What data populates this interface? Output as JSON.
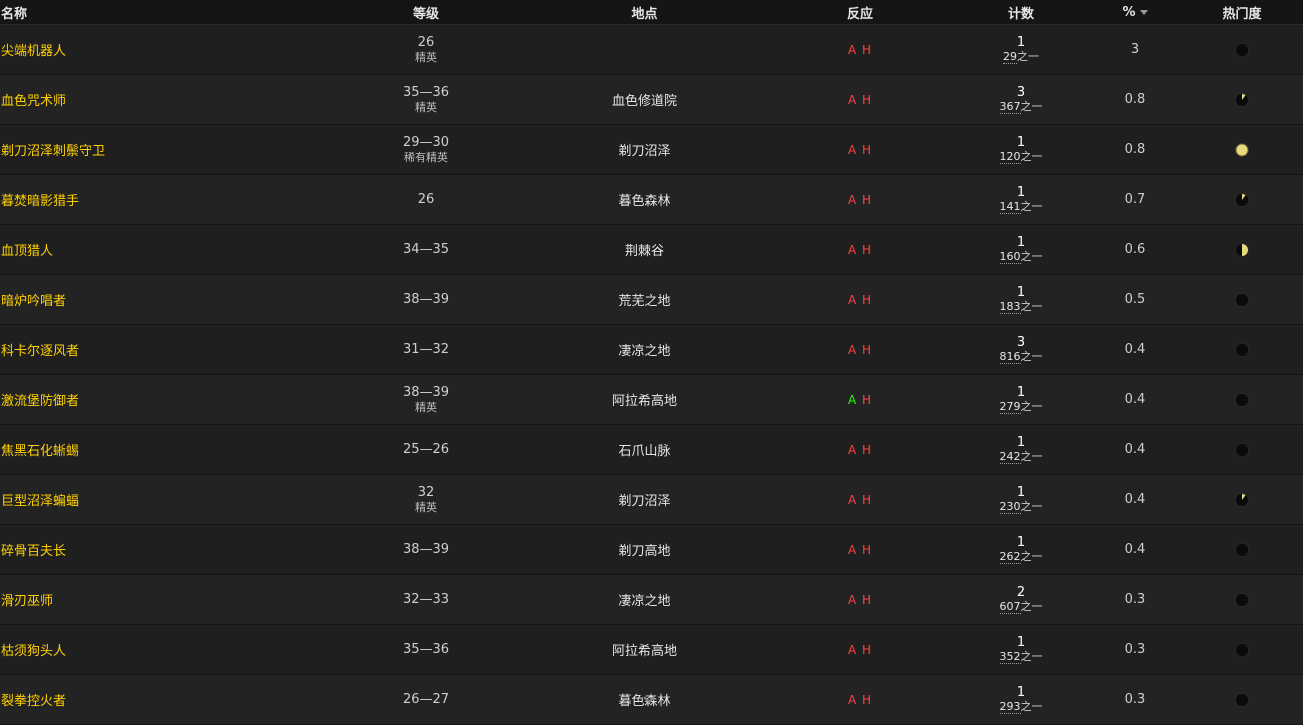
{
  "columns": {
    "name": "名称",
    "level": "等级",
    "zone": "地点",
    "react": "反应",
    "count": "计数",
    "pct": "%",
    "popularity": "热门度"
  },
  "react_labels": {
    "a": "A",
    "h": "H"
  },
  "count_suffix": "之一",
  "colors": {
    "name": "#ffd100",
    "react_red": "#ff4040",
    "react_green": "#1eff00",
    "pop_dark": "#0a0a0a",
    "pop_fill": "#e8d97a"
  },
  "rows": [
    {
      "name": "尖端机器人",
      "level": "26",
      "level_sub": "精英",
      "zone": "",
      "a": "red",
      "count": "1",
      "count_of": "29",
      "pct": "3",
      "pop": 0
    },
    {
      "name": "血色咒术师",
      "level": "35—36",
      "level_sub": "精英",
      "zone": "血色修道院",
      "a": "red",
      "count": "3",
      "count_of": "367",
      "pct": "0.8",
      "pop": 0.1
    },
    {
      "name": "剃刀沼泽刺鬃守卫",
      "level": "29—30",
      "level_sub": "稀有精英",
      "zone": "剃刀沼泽",
      "a": "red",
      "count": "1",
      "count_of": "120",
      "pct": "0.8",
      "pop": 1
    },
    {
      "name": "暮焚暗影猎手",
      "level": "26",
      "level_sub": "",
      "zone": "暮色森林",
      "a": "red",
      "count": "1",
      "count_of": "141",
      "pct": "0.7",
      "pop": 0.1
    },
    {
      "name": "血顶猎人",
      "level": "34—35",
      "level_sub": "",
      "zone": "荆棘谷",
      "a": "red",
      "count": "1",
      "count_of": "160",
      "pct": "0.6",
      "pop": 0.5
    },
    {
      "name": "暗炉吟唱者",
      "level": "38—39",
      "level_sub": "",
      "zone": "荒芜之地",
      "a": "red",
      "count": "1",
      "count_of": "183",
      "pct": "0.5",
      "pop": 0
    },
    {
      "name": "科卡尔逐风者",
      "level": "31—32",
      "level_sub": "",
      "zone": "凄凉之地",
      "a": "red",
      "count": "3",
      "count_of": "816",
      "pct": "0.4",
      "pop": 0
    },
    {
      "name": "激流堡防御者",
      "level": "38—39",
      "level_sub": "精英",
      "zone": "阿拉希高地",
      "a": "green",
      "count": "1",
      "count_of": "279",
      "pct": "0.4",
      "pop": 0
    },
    {
      "name": "焦黑石化蜥蜴",
      "level": "25—26",
      "level_sub": "",
      "zone": "石爪山脉",
      "a": "red",
      "count": "1",
      "count_of": "242",
      "pct": "0.4",
      "pop": 0
    },
    {
      "name": "巨型沼泽蝙蝠",
      "level": "32",
      "level_sub": "精英",
      "zone": "剃刀沼泽",
      "a": "red",
      "count": "1",
      "count_of": "230",
      "pct": "0.4",
      "pop": 0.1
    },
    {
      "name": "碎骨百夫长",
      "level": "38—39",
      "level_sub": "",
      "zone": "剃刀高地",
      "a": "red",
      "count": "1",
      "count_of": "262",
      "pct": "0.4",
      "pop": 0
    },
    {
      "name": "滑刃巫师",
      "level": "32—33",
      "level_sub": "",
      "zone": "凄凉之地",
      "a": "red",
      "count": "2",
      "count_of": "607",
      "pct": "0.3",
      "pop": 0
    },
    {
      "name": "枯须狗头人",
      "level": "35—36",
      "level_sub": "",
      "zone": "阿拉希高地",
      "a": "red",
      "count": "1",
      "count_of": "352",
      "pct": "0.3",
      "pop": 0
    },
    {
      "name": "裂拳控火者",
      "level": "26—27",
      "level_sub": "",
      "zone": "暮色森林",
      "a": "red",
      "count": "1",
      "count_of": "293",
      "pct": "0.3",
      "pop": 0
    }
  ]
}
